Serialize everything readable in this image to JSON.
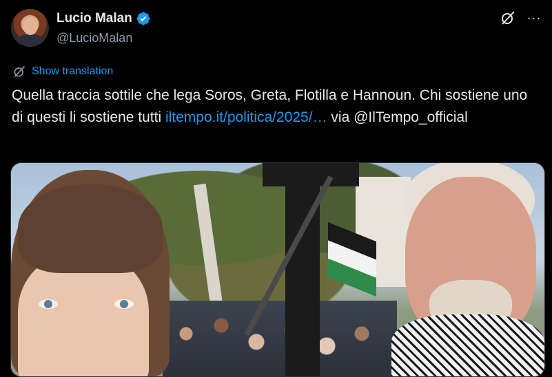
{
  "author": {
    "name": "Lucio Malan",
    "handle": "@LucioMalan",
    "verified": true
  },
  "actions": {
    "grok_icon": "grok-slash-icon",
    "more_icon": "more-dots-icon",
    "more_label": "···"
  },
  "translation": {
    "label": "Show translation"
  },
  "tweet": {
    "text_part1": "Quella traccia sottile che lega Soros, Greta, Flotilla e Hannoun. Chi sostiene uno di questi li sostiene tutti ",
    "link": "iltempo.it/politica/2025/…",
    "text_part2": " via ",
    "mention": "@IlTempo_official"
  },
  "colors": {
    "background": "#000000",
    "text": "#e7e9ea",
    "secondary": "#8b98a5",
    "accent": "#1d9bf0"
  }
}
